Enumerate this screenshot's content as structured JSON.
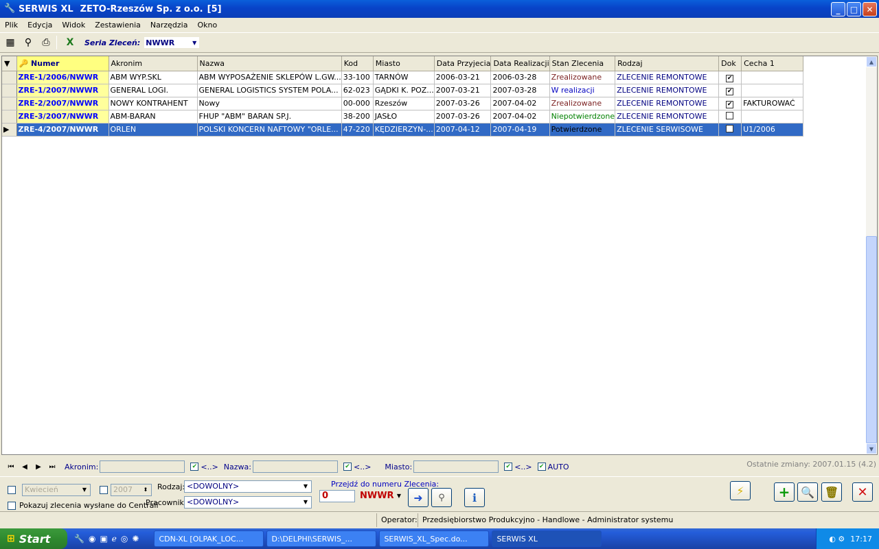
{
  "window": {
    "app": "SERWIS XL",
    "company": "ZETO-Rzeszów Sp. z o.o.",
    "count": "[5]"
  },
  "menu": [
    "Plik",
    "Edycja",
    "Widok",
    "Zestawienia",
    "Narzędzia",
    "Okno"
  ],
  "toolbar": {
    "series_label": "Seria Zleceń:",
    "series_value": "NWWR"
  },
  "grid": {
    "columns": [
      "Numer",
      "Akronim",
      "Nazwa",
      "Kod",
      "Miasto",
      "Data Przyjecia",
      "Data Realizacji",
      "Stan Zlecenia",
      "Rodzaj",
      "Dok",
      "Cecha 1"
    ],
    "rows": [
      {
        "numer": "ZRE-1/2006/NWWR",
        "akronim": "ABM WYP.SKL",
        "nazwa": "ABM WYPOSAŻENIE SKLEPÓW L.GW...",
        "kod": "33-100",
        "miasto": "TARNÓW",
        "data_p": "2006-03-21",
        "data_r": "2006-03-28",
        "stan": "Zrealizowane",
        "rodzaj": "ZLECENIE REMONTOWE",
        "dok": "✔",
        "cecha": ""
      },
      {
        "numer": "ZRE-1/2007/NWWR",
        "akronim": "GENERAL LOGI.",
        "nazwa": "GENERAL LOGISTICS SYSTEM POLA...",
        "kod": "62-023",
        "miasto": "GĄDKI K. POZ...",
        "data_p": "2007-03-21",
        "data_r": "2007-03-28",
        "stan": "W realizacji",
        "rodzaj": "ZLECENIE REMONTOWE",
        "dok": "✔",
        "cecha": ""
      },
      {
        "numer": "ZRE-2/2007/NWWR",
        "akronim": "NOWY KONTRAHENT",
        "nazwa": "Nowy",
        "kod": "00-000",
        "miasto": "Rzeszów",
        "data_p": "2007-03-26",
        "data_r": "2007-04-02",
        "stan": "Zrealizowane",
        "rodzaj": "ZLECENIE REMONTOWE",
        "dok": "✔",
        "cecha": "FAKTUROWAĆ"
      },
      {
        "numer": "ZRE-3/2007/NWWR",
        "akronim": "ABM-BARAN",
        "nazwa": "FHUP \"ABM\" BARAN SP.J.",
        "kod": "38-200",
        "miasto": "JASŁO",
        "data_p": "2007-03-26",
        "data_r": "2007-04-02",
        "stan": "Niepotwierdzone",
        "rodzaj": "ZLECENIE REMONTOWE",
        "dok": "",
        "cecha": ""
      },
      {
        "numer": "ZRE-4/2007/NWWR",
        "akronim": "ORLEN",
        "nazwa": "POLSKI KONCERN NAFTOWY \"ORLE...",
        "kod": "47-220",
        "miasto": "KĘDZIERZYN-...",
        "data_p": "2007-04-12",
        "data_r": "2007-04-19",
        "stan": "Potwierdzone",
        "rodzaj": "ZLECENIE SERWISOWE",
        "dok": "",
        "cecha": "U1/2006"
      }
    ]
  },
  "filters": {
    "akronim_label": "Akronim:",
    "nazwa_label": "Nazwa:",
    "miasto_label": "Miasto:",
    "any_symbol": "<..>",
    "auto_label": "AUTO",
    "last_change": "Ostatnie zmiany: 2007.01.15 (4.2)"
  },
  "bottom": {
    "month": "Kwiecień",
    "year": "2007",
    "rodzaj_label": "Rodzaj:",
    "rodzaj_value": "<DOWOLNY>",
    "pracownik_label": "Pracownik:",
    "pracownik_value": "<DOWOLNY>",
    "centrala_label": "Pokazuj zlecenia wysłane do Centrali",
    "goto_label": "Przejdź do numeru Zlecenia:",
    "goto_number": "0",
    "goto_series": "NWWR"
  },
  "status": {
    "operator_label": "Operator:",
    "operator_value": "Przedsiębiorstwo Produkcyjno - Handlowe - Administrator systemu"
  },
  "taskbar": {
    "start": "Start",
    "tasks": [
      "CDN-XL [OLPAK_LOC...",
      "D:\\DELPHI\\SERWIS_...",
      "SERWIS_XL_Spec.do...",
      "SERWIS XL"
    ],
    "clock": "17:17"
  }
}
